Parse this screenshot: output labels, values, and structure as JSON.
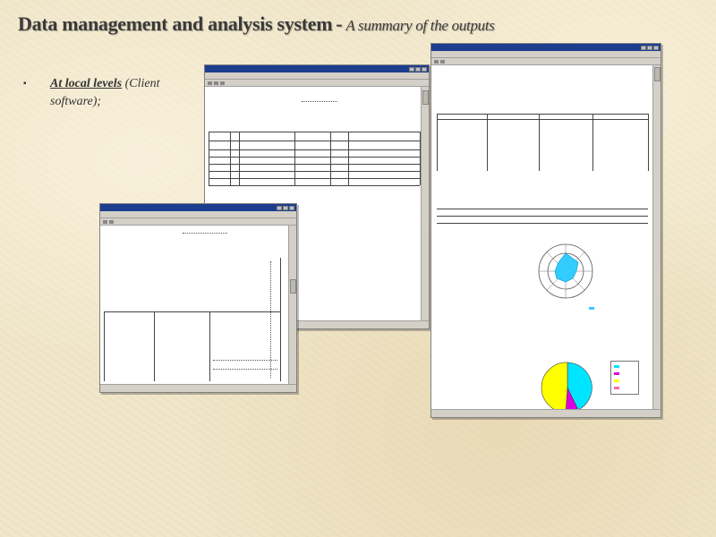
{
  "slide": {
    "title": "Data management and analysis system",
    "dash": "-",
    "subtitle": "A summary of the outputs",
    "bullet_symbol": "▪",
    "bullet_main": "At local levels",
    "bullet_paren": "(Client software);"
  },
  "windows": {
    "middle": {
      "title": ""
    },
    "left": {
      "title": ""
    },
    "right": {
      "title": ""
    }
  },
  "colors": {
    "titlebar": "#1d3e8f",
    "pie_cyan": "#00e5ff",
    "pie_magenta": "#e000e0",
    "pie_yellow": "#ffff00",
    "radar_fill": "#33ccff"
  },
  "icons": {
    "bullet": "square-bullet-icon",
    "minimize": "minimize-icon",
    "maximize": "maximize-icon",
    "close": "close-icon"
  }
}
